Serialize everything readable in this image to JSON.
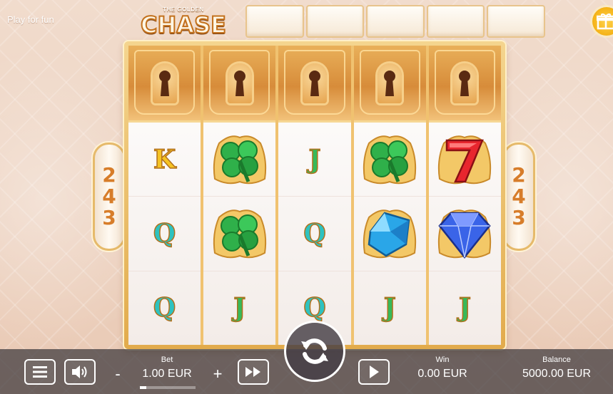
{
  "header": {
    "play_for_fun": "Play for fun",
    "logo_small": "THE GOLDEN",
    "logo_big": "CHASE",
    "progress_cells": 5
  },
  "multipliers": {
    "left": [
      "2",
      "4",
      "3"
    ],
    "right": [
      "2",
      "4",
      "3"
    ]
  },
  "reels": [
    {
      "locked": true,
      "symbols": [
        "K",
        "Q",
        "Q"
      ]
    },
    {
      "locked": true,
      "symbols": [
        "clover",
        "clover",
        "J"
      ]
    },
    {
      "locked": true,
      "symbols": [
        "J",
        "Q",
        "Q"
      ]
    },
    {
      "locked": true,
      "symbols": [
        "clover",
        "blue-gem",
        "J"
      ]
    },
    {
      "locked": true,
      "symbols": [
        "red-seven",
        "diamond",
        "J"
      ]
    }
  ],
  "controls": {
    "bet_label": "Bet",
    "bet_value": "1.00 EUR",
    "bet_minus": "-",
    "bet_plus": "+",
    "bet_level": 0.12,
    "win_label": "Win",
    "win_value": "0.00 EUR",
    "balance_label": "Balance",
    "balance_value": "5000.00 EUR"
  },
  "colors": {
    "gold": "#e2ab4c",
    "lock_bronze": "#d78c3a",
    "letter_K": "#f5c323",
    "letter_Q": "#2ec2c0",
    "letter_J": "#36b95a",
    "clover": "#2fb04a",
    "red_seven": "#e8262e",
    "blue_gem": "#2aa6e8",
    "diamond": "#3a64e8",
    "bar_bg": "#3c373c"
  },
  "icons": {
    "menu": "hamburger-icon",
    "sound": "speaker-icon",
    "turbo": "fast-forward-icon",
    "spin": "refresh-icon",
    "autoplay": "play-icon",
    "bonus": "gift-icon",
    "lock": "keyhole-icon"
  }
}
